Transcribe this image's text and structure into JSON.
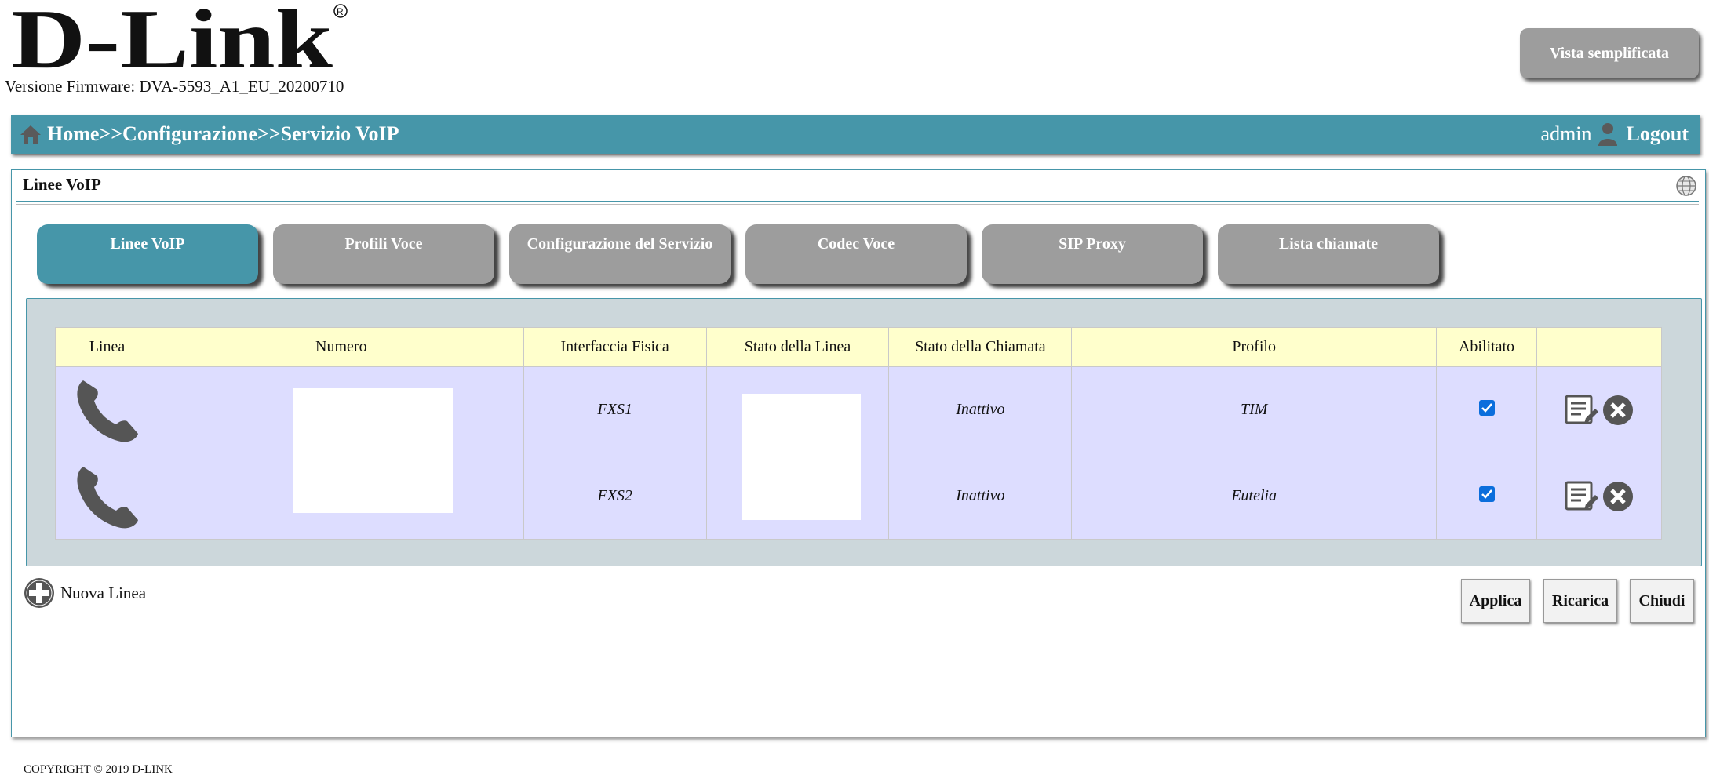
{
  "header": {
    "logo_text": "D-Link",
    "firmware": "Versione Firmware: DVA-5593_A1_EU_20200710",
    "simple_view_label": "Vista semplificata"
  },
  "nav": {
    "breadcrumb": "Home>>Configurazione>>Servizio VoIP",
    "user": "admin",
    "logout_label": "Logout"
  },
  "panel": {
    "title": "Linee VoIP"
  },
  "tabs": [
    {
      "label": "Linee VoIP",
      "active": true
    },
    {
      "label": "Profili Voce",
      "active": false
    },
    {
      "label": "Configurazione del Servizio",
      "active": false
    },
    {
      "label": "Codec Voce",
      "active": false
    },
    {
      "label": "SIP Proxy",
      "active": false
    },
    {
      "label": "Lista chiamate",
      "active": false
    }
  ],
  "table": {
    "headers": [
      "Linea",
      "Numero",
      "Interfaccia Fisica",
      "Stato della Linea",
      "Stato della Chiamata",
      "Profilo",
      "Abilitato",
      ""
    ],
    "rows": [
      {
        "interface": "FXS1",
        "call_state": "Inattivo",
        "profile": "TIM",
        "enabled": true
      },
      {
        "interface": "FXS2",
        "call_state": "Inattivo",
        "profile": "Eutelia",
        "enabled": true
      }
    ]
  },
  "actions": {
    "new_line_label": "Nuova Linea",
    "apply_label": "Applica",
    "reload_label": "Ricarica",
    "close_label": "Chiudi"
  },
  "footer": {
    "copyright": "COPYRIGHT © 2019 D-LINK"
  },
  "colors": {
    "accent": "#4696a9",
    "tab_inactive": "#9d9d9d",
    "header_row": "#ffffcc",
    "data_row": "#ddddff"
  }
}
